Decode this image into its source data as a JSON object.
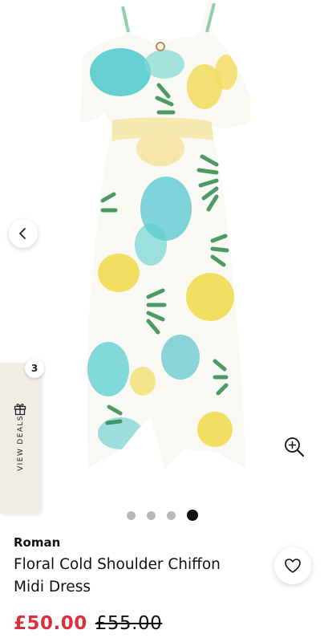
{
  "gallery": {
    "image_alt": "Floral cold shoulder chiffon midi dress",
    "slide_count": 4,
    "active_slide": 4
  },
  "controls": {
    "prev_icon": "chevron-left-icon",
    "zoom_icon": "zoom-in-icon"
  },
  "deals": {
    "badge_count": "3",
    "label": "VIEW DEALS",
    "icon": "gift-icon"
  },
  "product": {
    "brand": "Roman",
    "title": "Floral Cold Shoulder Chiffon Midi Dress",
    "price_current": "£50.00",
    "price_original": "£55.00",
    "favorite_icon": "heart-outline-icon"
  },
  "colors": {
    "sale_price": "#d9303f",
    "deals_tab_bg": "#f1ede5",
    "dot_inactive": "#b7b9bf",
    "dot_active": "#111111"
  }
}
